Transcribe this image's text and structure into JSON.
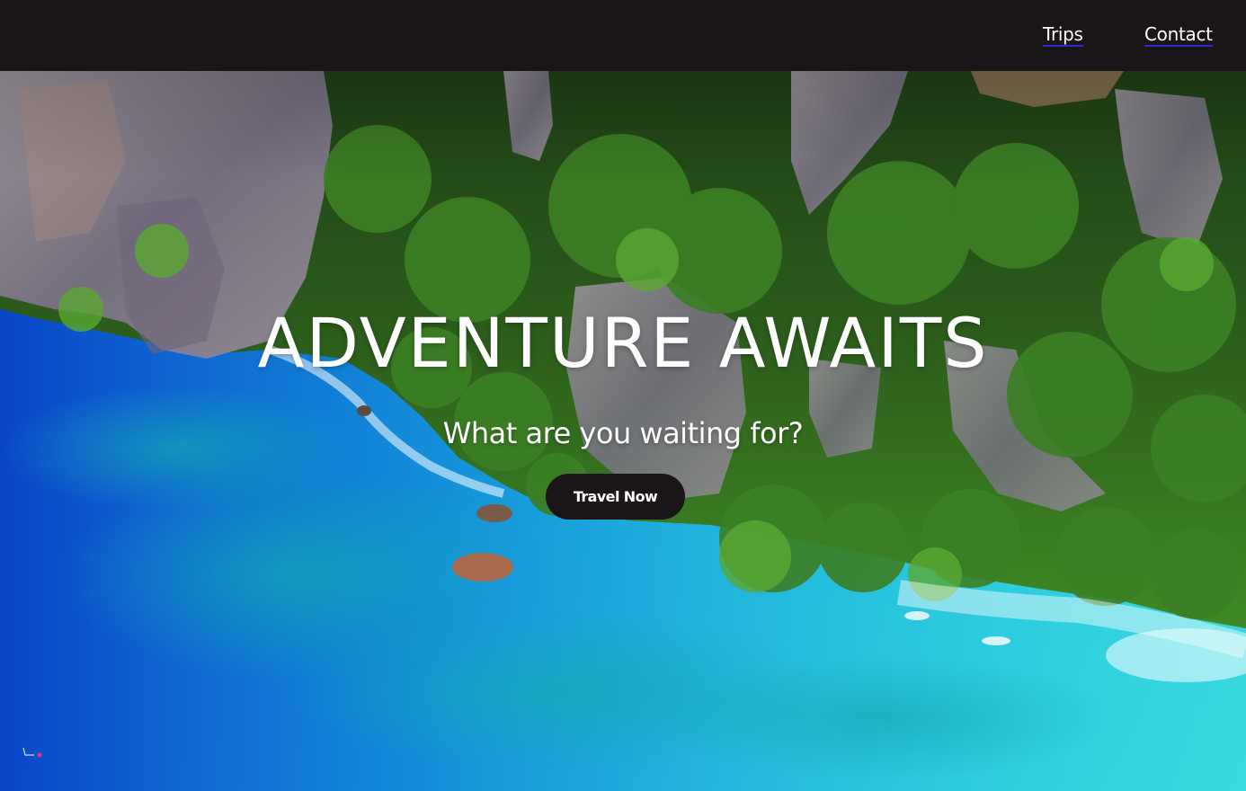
{
  "nav": {
    "trips_label": "Trips",
    "contact_label": "Contact"
  },
  "hero": {
    "title": "ADVENTURE AWAITS",
    "subtitle": "What are you waiting for?",
    "cta_label": "Travel Now"
  },
  "colors": {
    "navbar_bg": "#1a1617",
    "button_bg": "#1a1617",
    "text": "#ffffff",
    "link_underline": "#2b2bdb",
    "water_deep": "#0a4fd0",
    "water_shallow": "#33d6e0",
    "jungle": "#2f6b1f",
    "cliff": "#8a8296"
  },
  "background_image": "aerial-tropical-island-cliffs-turquoise-sea"
}
